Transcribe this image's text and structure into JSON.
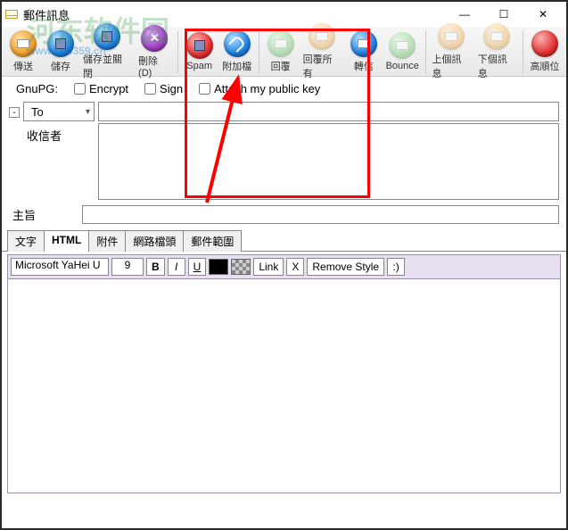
{
  "window": {
    "title": "郵件訊息"
  },
  "watermark": {
    "text": "河东软件园",
    "sub": "www.pc0359.cn"
  },
  "titlebar_controls": {
    "min": "—",
    "max": "☐",
    "close": "✕"
  },
  "toolbar": [
    {
      "id": "send",
      "label": "傳送",
      "color": "orange",
      "glyph": "env"
    },
    {
      "id": "save",
      "label": "儲存",
      "color": "blue",
      "glyph": "disk"
    },
    {
      "id": "saveclose",
      "label": "儲存並關閉",
      "color": "blue",
      "glyph": "disk"
    },
    {
      "id": "delete",
      "label": "刪除(D)",
      "color": "purple",
      "glyph": "x"
    },
    {
      "id": "spam",
      "label": "Spam",
      "color": "red",
      "glyph": "disk"
    },
    {
      "id": "attach",
      "label": "附加檔",
      "color": "blue",
      "glyph": "clip"
    },
    {
      "id": "reply",
      "label": "回覆",
      "color": "green",
      "glyph": "env",
      "faint": true
    },
    {
      "id": "replyall",
      "label": "回覆所有",
      "color": "orange",
      "glyph": "env",
      "faint": true
    },
    {
      "id": "forward",
      "label": "轉信",
      "color": "blue",
      "glyph": "env"
    },
    {
      "id": "bounce",
      "label": "Bounce",
      "color": "green",
      "glyph": "env",
      "faint": true
    },
    {
      "id": "prevmsg",
      "label": "上個訊息",
      "color": "orange",
      "glyph": "env",
      "faint": true
    },
    {
      "id": "nextmsg",
      "label": "下個訊息",
      "color": "orange",
      "glyph": "env",
      "faint": true
    },
    {
      "id": "priority",
      "label": "高順位",
      "color": "red",
      "glyph": ""
    }
  ],
  "gnupg": {
    "label": "GnuPG:",
    "encrypt": "Encrypt",
    "sign": "Sign",
    "attach_key": "Attach my public key"
  },
  "addr": {
    "to": "To",
    "recipients_label": "收信者"
  },
  "subject": {
    "label": "主旨"
  },
  "tabs": [
    "文字",
    "HTML",
    "附件",
    "網路檔頭",
    "郵件範圍"
  ],
  "active_tab": 1,
  "format": {
    "font": "Microsoft YaHei U",
    "size": "9",
    "bold": "B",
    "italic": "I",
    "underline": "U",
    "link": "Link",
    "x": "X",
    "remove": "Remove Style",
    "smile": ":)"
  }
}
